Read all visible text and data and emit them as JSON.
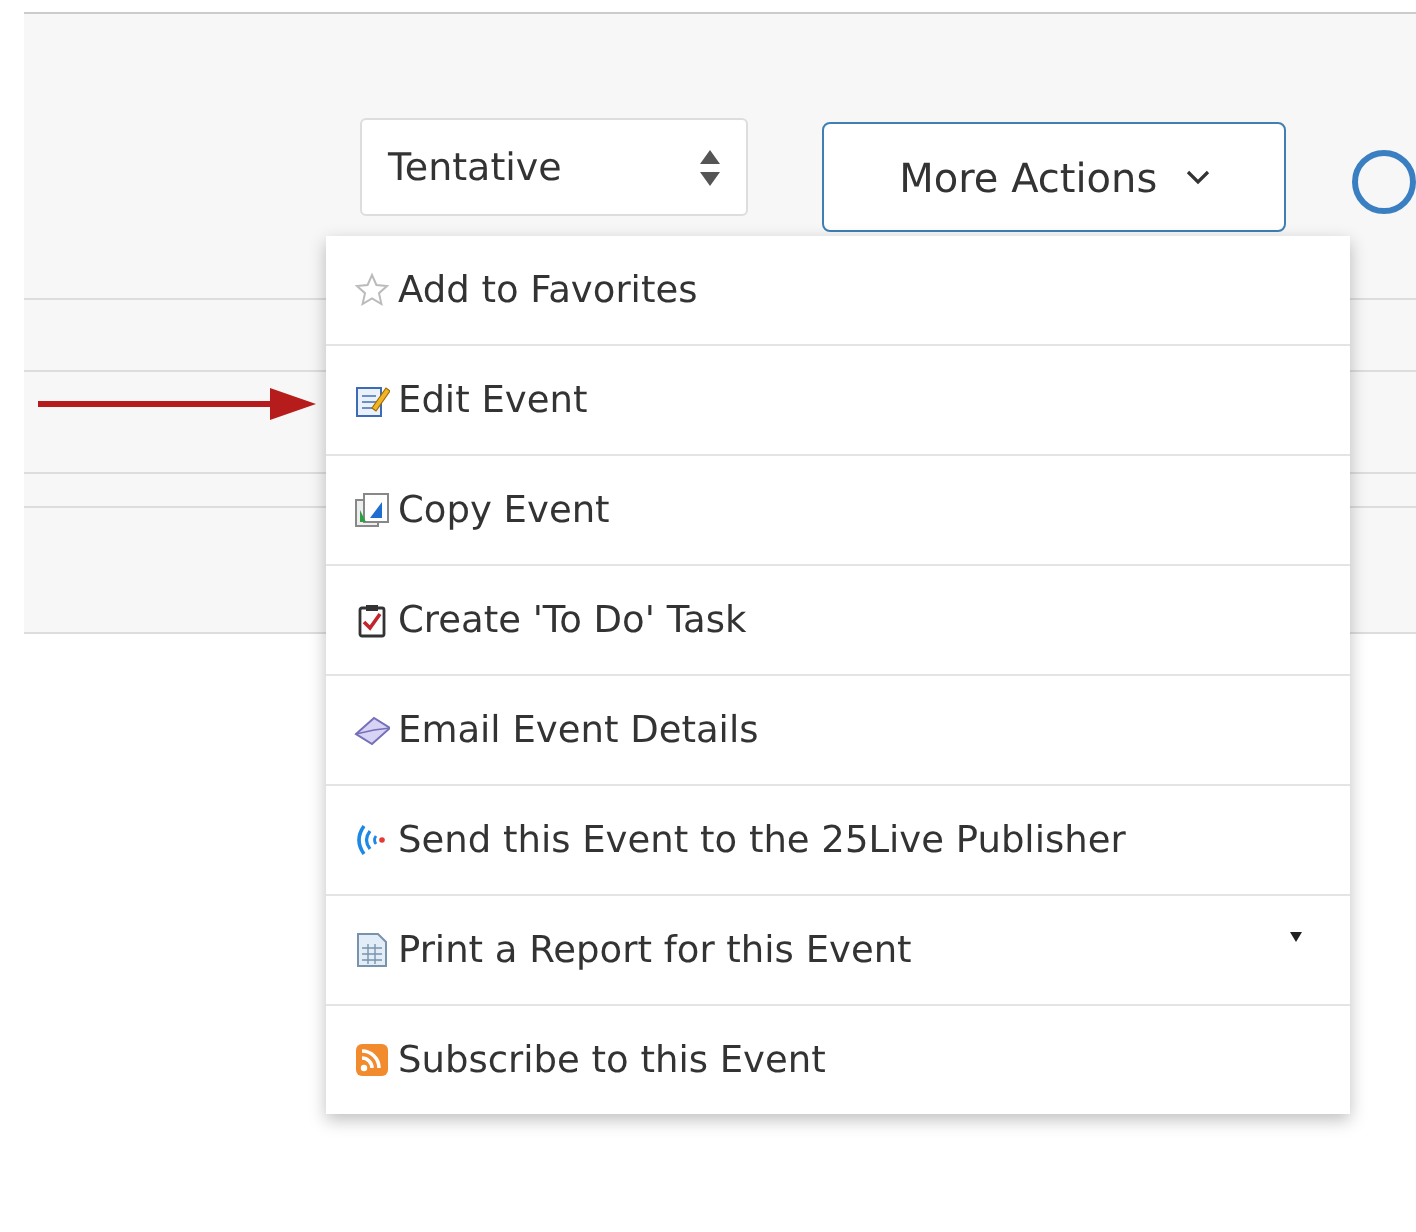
{
  "status_select": {
    "value": "Tentative"
  },
  "more_actions": {
    "label": "More Actions",
    "expanded": true
  },
  "menu": {
    "items": [
      {
        "kind": "star",
        "label": "Add to Favorites",
        "submenu": false
      },
      {
        "kind": "edit",
        "label": "Edit Event",
        "submenu": false,
        "pointed": true
      },
      {
        "kind": "copy",
        "label": "Copy Event",
        "submenu": false
      },
      {
        "kind": "todo",
        "label": "Create 'To Do' Task",
        "submenu": false
      },
      {
        "kind": "email",
        "label": "Email Event Details",
        "submenu": false
      },
      {
        "kind": "broadcast",
        "label": "Send this Event to the 25Live Publisher",
        "submenu": false
      },
      {
        "kind": "report",
        "label": "Print a Report for this Event",
        "submenu": true
      },
      {
        "kind": "rss",
        "label": "Subscribe to this Event",
        "submenu": false
      }
    ]
  }
}
